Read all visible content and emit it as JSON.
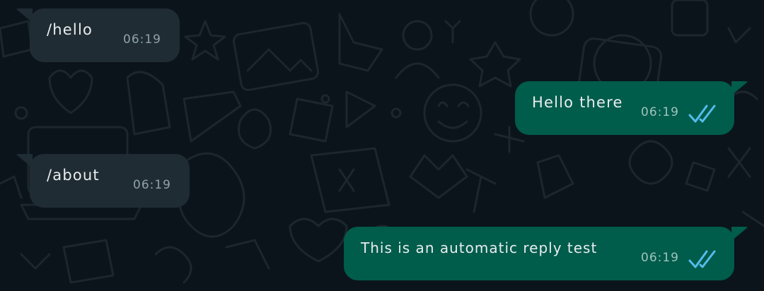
{
  "messages": [
    {
      "direction": "incoming",
      "text": "/hello",
      "time": "06:19"
    },
    {
      "direction": "outgoing",
      "text": "Hello there",
      "time": "06:19",
      "status": "read"
    },
    {
      "direction": "incoming",
      "text": "/about",
      "time": "06:19"
    },
    {
      "direction": "outgoing",
      "text": "This is an automatic reply test",
      "time": "06:19",
      "status": "read"
    }
  ],
  "colors": {
    "background": "#0b141a",
    "incoming_bubble": "#202c33",
    "outgoing_bubble": "#005c4b",
    "read_ticks": "#53bdeb",
    "text": "#e9edef"
  },
  "icons": {
    "read_status": "double-check-icon"
  }
}
